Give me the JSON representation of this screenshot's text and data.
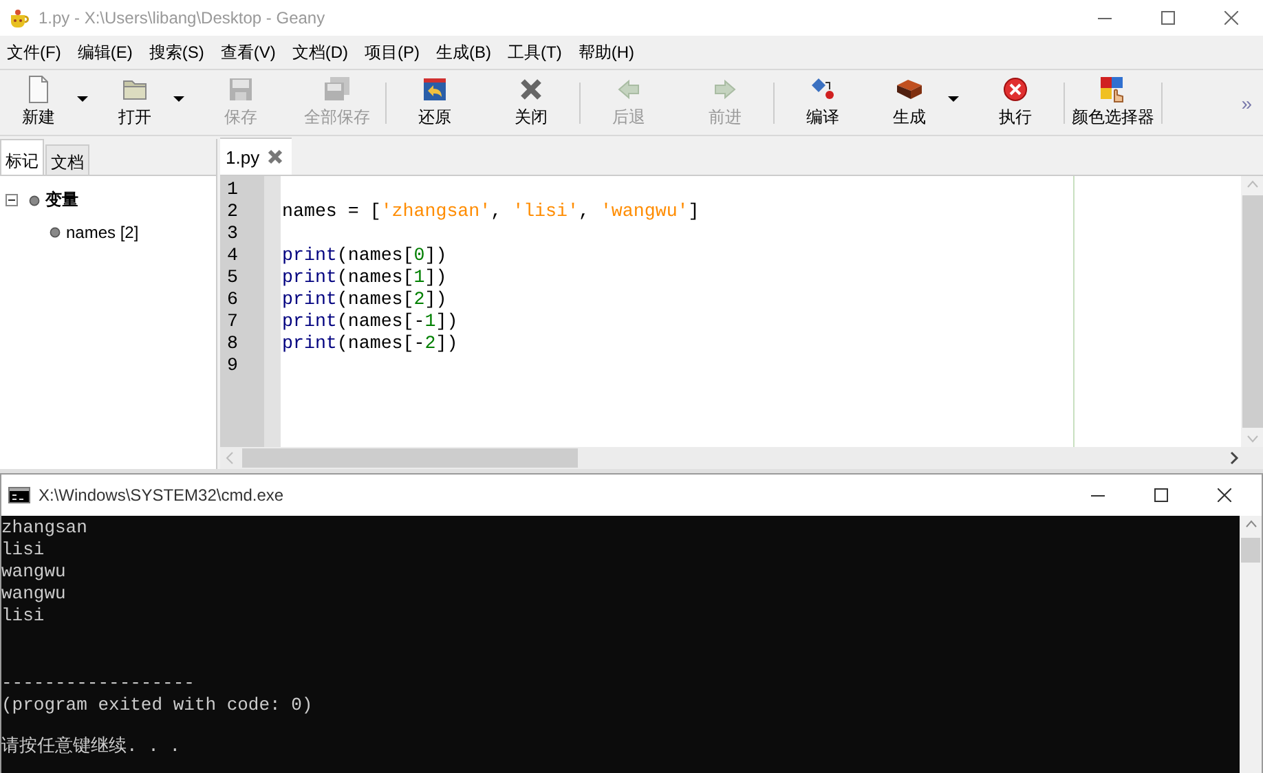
{
  "window": {
    "title": "1.py - X:\\Users\\libang\\Desktop - Geany"
  },
  "menu": [
    "文件(F)",
    "编辑(E)",
    "搜索(S)",
    "查看(V)",
    "文档(D)",
    "项目(P)",
    "生成(B)",
    "工具(T)",
    "帮助(H)"
  ],
  "toolbar": {
    "items": [
      {
        "kind": "button",
        "label": "新建",
        "disabled": false,
        "dropdown": true
      },
      {
        "kind": "button",
        "label": "打开",
        "disabled": false,
        "dropdown": true
      },
      {
        "kind": "button",
        "label": "保存",
        "disabled": true,
        "dropdown": false
      },
      {
        "kind": "button",
        "label": "全部保存",
        "disabled": true,
        "dropdown": false
      },
      {
        "kind": "separator"
      },
      {
        "kind": "button",
        "label": "还原",
        "disabled": false,
        "dropdown": false
      },
      {
        "kind": "button",
        "label": "关闭",
        "disabled": false,
        "dropdown": false
      },
      {
        "kind": "separator"
      },
      {
        "kind": "button",
        "label": "后退",
        "disabled": true,
        "dropdown": false
      },
      {
        "kind": "button",
        "label": "前进",
        "disabled": true,
        "dropdown": false
      },
      {
        "kind": "separator"
      },
      {
        "kind": "button",
        "label": "编译",
        "disabled": false,
        "dropdown": false
      },
      {
        "kind": "button",
        "label": "生成",
        "disabled": false,
        "dropdown": true
      },
      {
        "kind": "button",
        "label": "执行",
        "disabled": false,
        "dropdown": false
      },
      {
        "kind": "separator"
      },
      {
        "kind": "button",
        "label": "颜色选择器",
        "disabled": false,
        "dropdown": false
      },
      {
        "kind": "separator"
      }
    ],
    "overflow": "»"
  },
  "sidebar": {
    "tabs": [
      {
        "label": "标记",
        "selected": true
      },
      {
        "label": "文档",
        "selected": false
      }
    ],
    "tree": [
      {
        "label": "变量",
        "expanded": true,
        "children": [
          {
            "label": "names [2]"
          }
        ]
      }
    ]
  },
  "editor": {
    "tab": {
      "label": "1.py"
    },
    "lines": [
      {
        "number": "1"
      },
      {
        "number": "2",
        "tokens": [
          {
            "kind": "text",
            "text": "names"
          },
          {
            "kind": "operator",
            "text": " = ["
          },
          {
            "kind": "string",
            "text": "'zhangsan'"
          },
          {
            "kind": "operator",
            "text": ", "
          },
          {
            "kind": "string",
            "text": "'lisi'"
          },
          {
            "kind": "operator",
            "text": ", "
          },
          {
            "kind": "string",
            "text": "'wangwu'"
          },
          {
            "kind": "operator",
            "text": "]"
          }
        ]
      },
      {
        "number": "3"
      },
      {
        "number": "4",
        "tokens": [
          {
            "kind": "keyword",
            "text": "print"
          },
          {
            "kind": "operator",
            "text": "("
          },
          {
            "kind": "text",
            "text": "names"
          },
          {
            "kind": "operator",
            "text": "["
          },
          {
            "kind": "number",
            "text": "0"
          },
          {
            "kind": "operator",
            "text": "])"
          }
        ]
      },
      {
        "number": "5",
        "tokens": [
          {
            "kind": "keyword",
            "text": "print"
          },
          {
            "kind": "operator",
            "text": "("
          },
          {
            "kind": "text",
            "text": "names"
          },
          {
            "kind": "operator",
            "text": "["
          },
          {
            "kind": "number",
            "text": "1"
          },
          {
            "kind": "operator",
            "text": "])"
          }
        ]
      },
      {
        "number": "6",
        "tokens": [
          {
            "kind": "keyword",
            "text": "print"
          },
          {
            "kind": "operator",
            "text": "("
          },
          {
            "kind": "text",
            "text": "names"
          },
          {
            "kind": "operator",
            "text": "["
          },
          {
            "kind": "number",
            "text": "2"
          },
          {
            "kind": "operator",
            "text": "])"
          }
        ]
      },
      {
        "number": "7",
        "tokens": [
          {
            "kind": "keyword",
            "text": "print"
          },
          {
            "kind": "operator",
            "text": "("
          },
          {
            "kind": "text",
            "text": "names"
          },
          {
            "kind": "operator",
            "text": "[-"
          },
          {
            "kind": "number",
            "text": "1"
          },
          {
            "kind": "operator",
            "text": "])"
          }
        ]
      },
      {
        "number": "8",
        "tokens": [
          {
            "kind": "keyword",
            "text": "print"
          },
          {
            "kind": "operator",
            "text": "("
          },
          {
            "kind": "text",
            "text": "names"
          },
          {
            "kind": "operator",
            "text": "[-"
          },
          {
            "kind": "number",
            "text": "2"
          },
          {
            "kind": "operator",
            "text": "])"
          }
        ]
      },
      {
        "number": "9"
      }
    ]
  },
  "console": {
    "title": "X:\\Windows\\SYSTEM32\\cmd.exe",
    "blocks": [
      [
        "zhangsan",
        "lisi",
        "wangwu",
        "wangwu",
        "lisi"
      ],
      [
        "------------------",
        "(program exited with code: 0)"
      ],
      [
        "请按任意键继续. . ."
      ]
    ]
  }
}
